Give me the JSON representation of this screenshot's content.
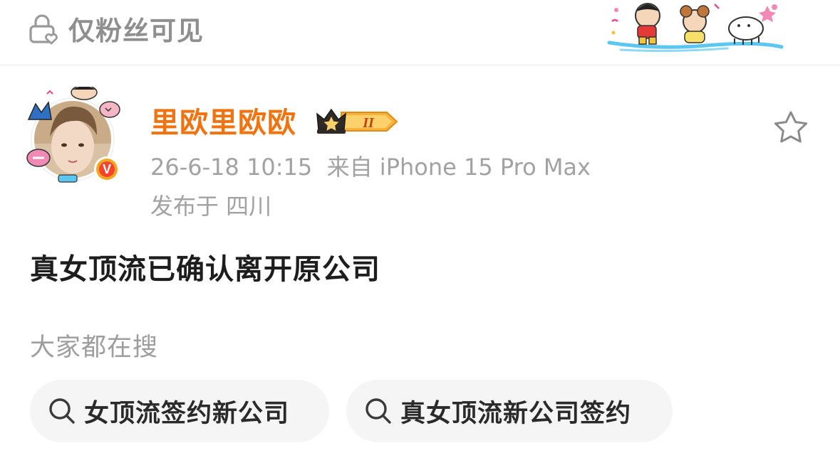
{
  "header": {
    "visibility_label": "仅粉丝可见",
    "visibility_icon": "lock-heart-icon",
    "sticker": "crayon-shinchan-characters-sticker"
  },
  "post": {
    "author": {
      "name": "里欧里欧欧",
      "name_color": "#f0730f",
      "level_badge": "II",
      "verified_badge": "V"
    },
    "timestamp": "26-6-18 10:15",
    "source": "来自 iPhone 15 Pro Max",
    "location": "发布于 四川",
    "favorite_icon": "star-outline-icon",
    "text": "真女顶流已确认离开原公司"
  },
  "search": {
    "heading": "大家都在搜",
    "chips": [
      {
        "label": "女顶流签约新公司",
        "icon": "search-icon"
      },
      {
        "label": "真女顶流新公司签约",
        "icon": "search-icon"
      }
    ]
  }
}
